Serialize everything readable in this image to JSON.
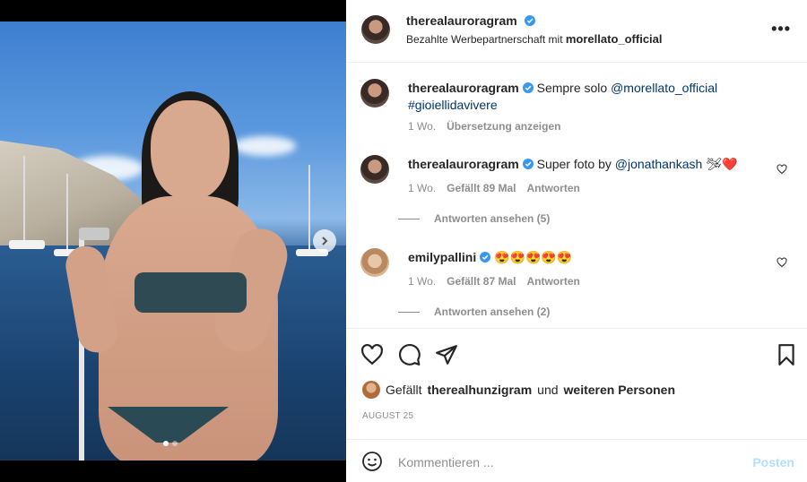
{
  "post": {
    "author": "therealauroragram",
    "partnership_prefix": "Bezahlte Werbepartnerschaft mit",
    "partner": "morellato_official",
    "more_icon": "more-horizontal-icon"
  },
  "comments": [
    {
      "username": "therealauroragram",
      "text_prefix": "Sempre solo",
      "mention": "@morellato_official",
      "hashtag": "#gioiellidavivere",
      "age": "1 Wo.",
      "translate": "Übersetzung anzeigen"
    },
    {
      "username": "therealauroragram",
      "text_prefix": "Super foto by",
      "mention": "@jonathankash",
      "emoji": "🛩❤️",
      "age": "1 Wo.",
      "likes": "Gefällt 89 Mal",
      "reply": "Antworten",
      "view_replies": "Antworten ansehen (5)"
    },
    {
      "username": "emilypallini",
      "emoji": "😍😍😍😍😍",
      "age": "1 Wo.",
      "likes": "Gefällt 87 Mal",
      "reply": "Antworten",
      "view_replies": "Antworten ansehen (2)"
    }
  ],
  "likes_line": {
    "prefix": "Gefällt",
    "user": "therealhunzigram",
    "middle": "und",
    "suffix": "weiteren Personen"
  },
  "date": "AUGUST 25",
  "add_comment": {
    "placeholder": "Kommentieren ...",
    "post_label": "Posten"
  },
  "carousel": {
    "current": 1,
    "total": 2
  },
  "colors": {
    "verified": "#3897f0",
    "link": "#00376b",
    "post_disabled": "#b2dffc"
  }
}
